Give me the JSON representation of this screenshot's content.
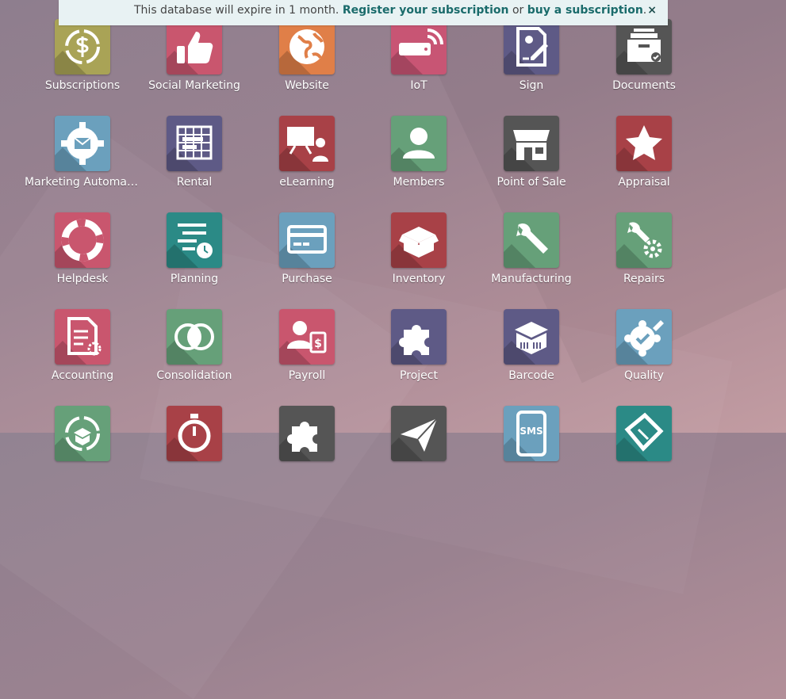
{
  "banner": {
    "text": "This database will expire in 1 month.",
    "link1": "Register your subscription",
    "middle": "or",
    "link2": "buy a subscription",
    "end": ".",
    "close": "×"
  },
  "apps": [
    {
      "label": "Subscriptions",
      "icon": "subscription-icon",
      "color": "#a9a356"
    },
    {
      "label": "Social Marketing",
      "icon": "thumbs-up-icon",
      "color": "#c9566e"
    },
    {
      "label": "Website",
      "icon": "globe-icon",
      "color": "#e07f48"
    },
    {
      "label": "IoT",
      "icon": "iot-device-icon",
      "color": "#c85574"
    },
    {
      "label": "Sign",
      "icon": "sign-document-icon",
      "color": "#5e5a86"
    },
    {
      "label": "Documents",
      "icon": "documents-inbox-icon",
      "color": "#555555"
    },
    {
      "label": "Marketing Automation",
      "icon": "gear-envelope-icon",
      "color": "#6ba0bd"
    },
    {
      "label": "Rental",
      "icon": "rental-calendar-icon",
      "color": "#5e5a86"
    },
    {
      "label": "eLearning",
      "icon": "elearning-presenter-icon",
      "color": "#a84147"
    },
    {
      "label": "Members",
      "icon": "member-person-icon",
      "color": "#66a079"
    },
    {
      "label": "Point of Sale",
      "icon": "shop-icon",
      "color": "#555555"
    },
    {
      "label": "Appraisal",
      "icon": "star-icon",
      "color": "#a84147"
    },
    {
      "label": "Helpdesk",
      "icon": "lifebuoy-icon",
      "color": "#c9566e"
    },
    {
      "label": "Planning",
      "icon": "planning-clock-icon",
      "color": "#2b8a86"
    },
    {
      "label": "Purchase",
      "icon": "credit-card-icon",
      "color": "#6ba0bd"
    },
    {
      "label": "Inventory",
      "icon": "open-box-icon",
      "color": "#a84147"
    },
    {
      "label": "Manufacturing",
      "icon": "wrench-icon",
      "color": "#66a079"
    },
    {
      "label": "Repairs",
      "icon": "wrench-gear-icon",
      "color": "#66a079"
    },
    {
      "label": "Accounting",
      "icon": "accounting-document-icon",
      "color": "#c9566e"
    },
    {
      "label": "Consolidation",
      "icon": "overlapping-circles-icon",
      "color": "#66a079"
    },
    {
      "label": "Payroll",
      "icon": "payroll-person-icon",
      "color": "#c9566e"
    },
    {
      "label": "Project",
      "icon": "puzzle-icon",
      "color": "#5e5a86"
    },
    {
      "label": "Barcode",
      "icon": "barcode-box-icon",
      "color": "#5e5a86"
    },
    {
      "label": "Quality",
      "icon": "quality-badge-icon",
      "color": "#6ba0bd"
    },
    {
      "label": "",
      "icon": "recurring-box-icon",
      "color": "#66a079"
    },
    {
      "label": "",
      "icon": "stopwatch-icon",
      "color": "#a84147"
    },
    {
      "label": "",
      "icon": "puzzle-piece-icon",
      "color": "#555555"
    },
    {
      "label": "",
      "icon": "paper-plane-icon",
      "color": "#555555"
    },
    {
      "label": "",
      "icon": "sms-phone-icon",
      "color": "#6ba0bd"
    },
    {
      "label": "",
      "icon": "ticket-icon",
      "color": "#2b8a86"
    }
  ]
}
